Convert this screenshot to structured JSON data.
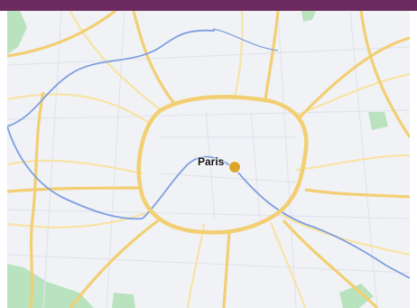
{
  "colors": {
    "header_bar": "#6b2b5f",
    "map_background": "#f1f2f6",
    "road_major": "#f2cf73",
    "road_minor": "#f7e3a6",
    "street": "#e1e4ec",
    "water": "#7d9fe0",
    "park": "#b9e3bf",
    "marker": "#d9a52c"
  },
  "map": {
    "city_label": "Paris",
    "marker_icon": "location-dot-icon"
  }
}
